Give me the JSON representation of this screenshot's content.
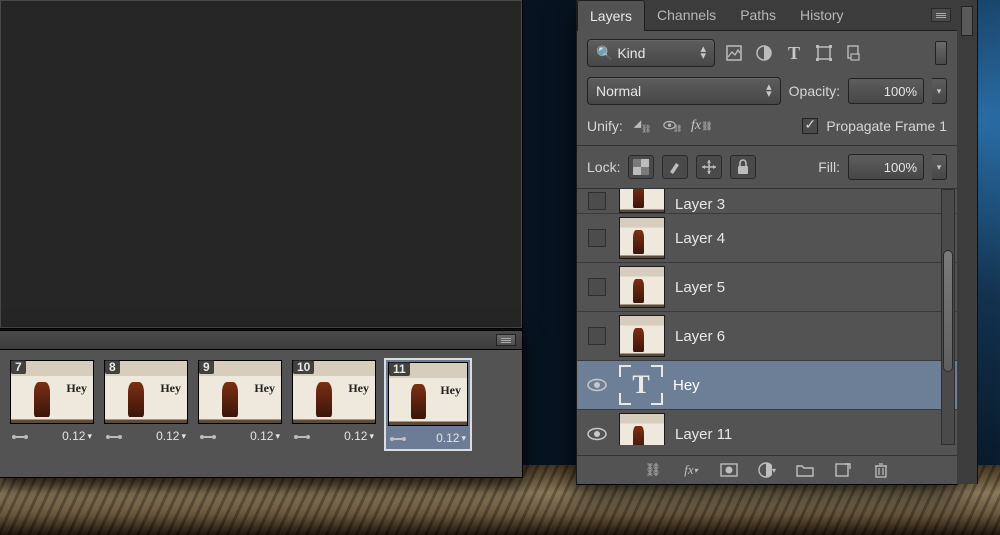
{
  "timeline": {
    "frames": [
      {
        "num": "7",
        "delay": "0.12",
        "thumb_text": "Hey"
      },
      {
        "num": "8",
        "delay": "0.12",
        "thumb_text": "Hey"
      },
      {
        "num": "9",
        "delay": "0.12",
        "thumb_text": "Hey"
      },
      {
        "num": "10",
        "delay": "0.12",
        "thumb_text": "Hey"
      },
      {
        "num": "11",
        "delay": "0.12",
        "thumb_text": "Hey",
        "selected": true
      }
    ]
  },
  "panel": {
    "tabs": [
      "Layers",
      "Channels",
      "Paths",
      "History"
    ],
    "active_tab": 0,
    "filter_label": "Kind",
    "blend_mode": "Normal",
    "opacity_label": "Opacity:",
    "opacity_value": "100%",
    "unify_label": "Unify:",
    "propagate_label": "Propagate Frame 1",
    "propagate_checked": true,
    "lock_label": "Lock:",
    "fill_label": "Fill:",
    "fill_value": "100%"
  },
  "layers": [
    {
      "name": "Layer 3",
      "visible": false,
      "cut": true,
      "type": "image"
    },
    {
      "name": "Layer 4",
      "visible": false,
      "type": "image"
    },
    {
      "name": "Layer 5",
      "visible": false,
      "type": "image"
    },
    {
      "name": "Layer 6",
      "visible": false,
      "type": "image"
    },
    {
      "name": "Hey",
      "visible": true,
      "type": "text",
      "selected": true
    },
    {
      "name": "Layer 11",
      "visible": true,
      "type": "image"
    }
  ]
}
